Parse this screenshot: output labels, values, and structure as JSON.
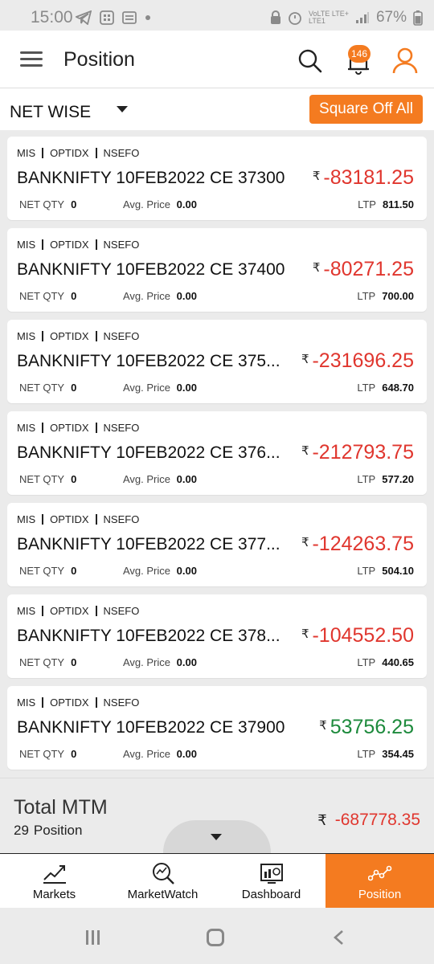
{
  "status_bar": {
    "time": "15:00",
    "network": "VoLTE LTE+",
    "network_sub": "LTE1",
    "battery": "67%"
  },
  "header": {
    "title": "Position",
    "notification_count": "146",
    "icons": [
      "menu-icon",
      "search-icon",
      "bell-icon",
      "user-icon"
    ]
  },
  "filter": {
    "mode": "NET WISE",
    "square_off_label": "Square Off All"
  },
  "positions": [
    {
      "product": "MIS",
      "segment": "OPTIDX",
      "exchange": "NSEFO",
      "symbol": "BANKNIFTY 10FEB2022 CE 37300",
      "currency": "₹",
      "pnl": "-83181.25",
      "pnl_color": "#e0362e",
      "net_qty_label": "NET QTY",
      "net_qty": "0",
      "avg_label": "Avg. Price",
      "avg_price": "0.00",
      "ltp_label": "LTP",
      "ltp": "811.50"
    },
    {
      "product": "MIS",
      "segment": "OPTIDX",
      "exchange": "NSEFO",
      "symbol": "BANKNIFTY 10FEB2022 CE 37400",
      "currency": "₹",
      "pnl": "-80271.25",
      "pnl_color": "#e0362e",
      "net_qty_label": "NET QTY",
      "net_qty": "0",
      "avg_label": "Avg. Price",
      "avg_price": "0.00",
      "ltp_label": "LTP",
      "ltp": "700.00"
    },
    {
      "product": "MIS",
      "segment": "OPTIDX",
      "exchange": "NSEFO",
      "symbol": "BANKNIFTY 10FEB2022 CE 375...",
      "currency": "₹",
      "pnl": "-231696.25",
      "pnl_color": "#e0362e",
      "net_qty_label": "NET QTY",
      "net_qty": "0",
      "avg_label": "Avg. Price",
      "avg_price": "0.00",
      "ltp_label": "LTP",
      "ltp": "648.70"
    },
    {
      "product": "MIS",
      "segment": "OPTIDX",
      "exchange": "NSEFO",
      "symbol": "BANKNIFTY 10FEB2022 CE 376...",
      "currency": "₹",
      "pnl": "-212793.75",
      "pnl_color": "#e0362e",
      "net_qty_label": "NET QTY",
      "net_qty": "0",
      "avg_label": "Avg. Price",
      "avg_price": "0.00",
      "ltp_label": "LTP",
      "ltp": "577.20"
    },
    {
      "product": "MIS",
      "segment": "OPTIDX",
      "exchange": "NSEFO",
      "symbol": "BANKNIFTY 10FEB2022 CE 377...",
      "currency": "₹",
      "pnl": "-124263.75",
      "pnl_color": "#e0362e",
      "net_qty_label": "NET QTY",
      "net_qty": "0",
      "avg_label": "Avg. Price",
      "avg_price": "0.00",
      "ltp_label": "LTP",
      "ltp": "504.10"
    },
    {
      "product": "MIS",
      "segment": "OPTIDX",
      "exchange": "NSEFO",
      "symbol": "BANKNIFTY 10FEB2022 CE 378...",
      "currency": "₹",
      "pnl": "-104552.50",
      "pnl_color": "#e0362e",
      "net_qty_label": "NET QTY",
      "net_qty": "0",
      "avg_label": "Avg. Price",
      "avg_price": "0.00",
      "ltp_label": "LTP",
      "ltp": "440.65"
    },
    {
      "product": "MIS",
      "segment": "OPTIDX",
      "exchange": "NSEFO",
      "symbol": "BANKNIFTY 10FEB2022 CE 37900",
      "currency": "₹",
      "pnl": "53756.25",
      "pnl_color": "#1d8a3c",
      "net_qty_label": "NET QTY",
      "net_qty": "0",
      "avg_label": "Avg. Price",
      "avg_price": "0.00",
      "ltp_label": "LTP",
      "ltp": "354.45"
    }
  ],
  "total": {
    "label": "Total MTM",
    "count": "29",
    "count_label": "Position",
    "currency": "₹",
    "value": "-687778.35"
  },
  "bottom_nav": [
    {
      "label": "Markets",
      "icon": "chart-line-icon",
      "active": false
    },
    {
      "label": "MarketWatch",
      "icon": "market-watch-icon",
      "active": false
    },
    {
      "label": "Dashboard",
      "icon": "dashboard-icon",
      "active": false
    },
    {
      "label": "Position",
      "icon": "position-icon",
      "active": true
    }
  ],
  "colors": {
    "accent": "#f47b20",
    "negative": "#e0362e",
    "positive": "#1d8a3c"
  }
}
